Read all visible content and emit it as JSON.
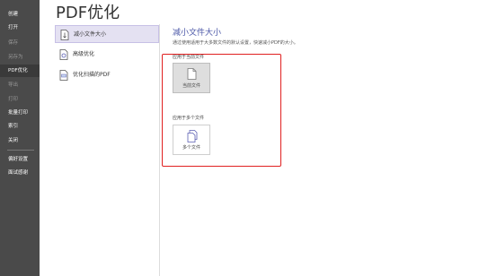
{
  "sidebar": {
    "items": [
      {
        "label": "创建"
      },
      {
        "label": "打开"
      },
      {
        "label": "保存"
      },
      {
        "label": "另存为"
      },
      {
        "label": "PDF优化"
      },
      {
        "label": "导出"
      },
      {
        "label": "打印"
      },
      {
        "label": "批量打印"
      },
      {
        "label": "索引"
      },
      {
        "label": "关闭"
      },
      {
        "label": "偏好设置"
      },
      {
        "label": "面试感谢"
      }
    ]
  },
  "page": {
    "title": "PDF优化"
  },
  "options": {
    "items": [
      {
        "label": "减小文件大小",
        "icon": "file-size-icon"
      },
      {
        "label": "高级优化",
        "icon": "advanced-optimize-icon"
      },
      {
        "label": "优化扫描的PDF",
        "icon": "scan-pdf-icon"
      }
    ]
  },
  "content": {
    "title": "减小文件大小",
    "description": "通过使用适用于大多数文件的默认设置，快速减小PDF的大小。",
    "single_section_label": "应用于当前文件",
    "single_button_label": "当前文件",
    "multi_section_label": "应用于多个文件",
    "multi_button_label": "多个文件"
  },
  "colors": {
    "sidebar_bg": "#4a4a4a",
    "selected_option_bg": "#e4e1f2",
    "title_accent": "#4b57a7",
    "highlight_frame": "#e02020"
  }
}
